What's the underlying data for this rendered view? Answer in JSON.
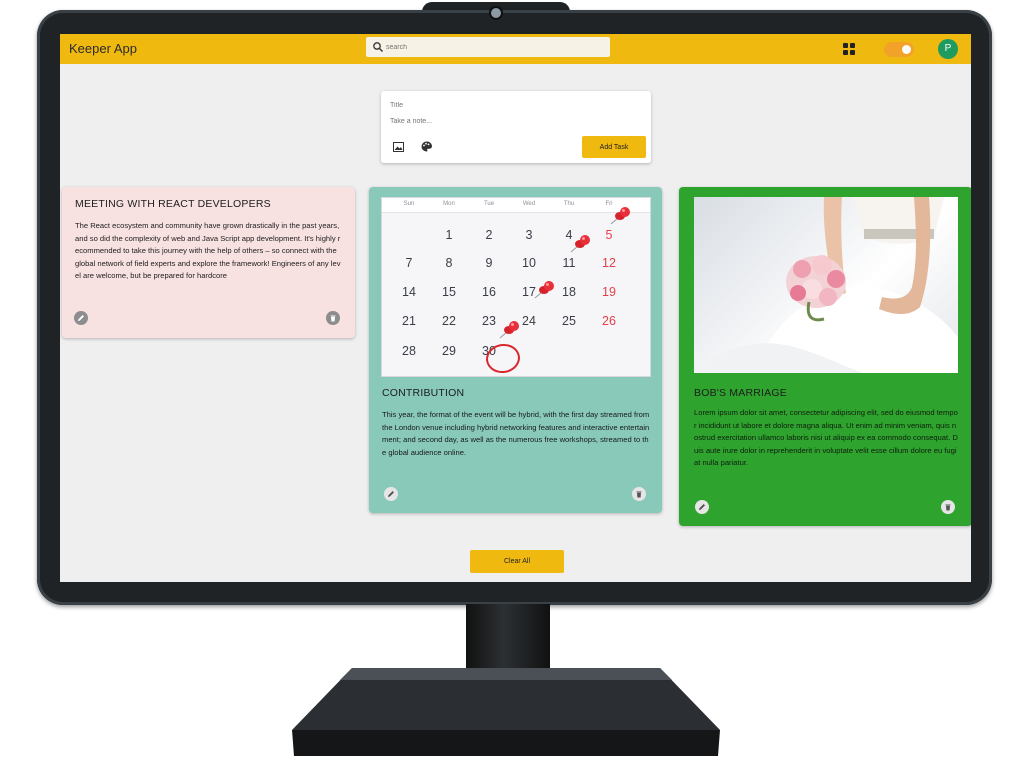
{
  "header": {
    "app_title": "Keeper App",
    "search_placeholder": "search",
    "avatar_letter": "P",
    "accent_color": "#f0b90f"
  },
  "composer": {
    "title_placeholder": "Title",
    "body_placeholder": "Take a note...",
    "add_button_label": "Add Task"
  },
  "notes": [
    {
      "title": "MEETING WITH REACT DEVELOPERS",
      "text": "The React ecosystem and community have grown drastically in the past years, and so did the complexity of web and Java Script app development. It's highly recommended to take this journey with the help of others – so connect with the global network of field experts and explore the framework! Engineers of any level are welcome, but be prepared for hardcore",
      "color": "#f8e1e1"
    },
    {
      "title": "CONTRIBUTION",
      "text": "This year, the format of the event will be hybrid, with the first day streamed from the London venue including hybrid networking features and interactive entertainment; and second day, as well as the numerous free workshops, streamed to the global audience online.",
      "color": "#88c9ba",
      "image": {
        "weekdays": [
          "Sun",
          "Mon",
          "Tue",
          "Wed",
          "Thu",
          "Fri"
        ],
        "rows": [
          [
            "",
            "1",
            "2",
            "3",
            "4",
            "5"
          ],
          [
            "7",
            "8",
            "9",
            "10",
            "11",
            "12"
          ],
          [
            "14",
            "15",
            "16",
            "17",
            "18",
            "19"
          ],
          [
            "21",
            "22",
            "23",
            "24",
            "25",
            "26"
          ],
          [
            "28",
            "29",
            "30",
            "",
            "",
            ""
          ]
        ],
        "circled_day": "30"
      }
    },
    {
      "title": "BOB'S MARRIAGE",
      "text": "Lorem ipsum dolor sit amet, consectetur adipiscing elit, sed do eiusmod tempor incididunt ut labore et dolore magna aliqua. Ut enim ad minim veniam, quis nostrud exercitation ullamco laboris nisi ut aliquip ex ea commodo consequat. Duis aute irure dolor in reprehenderit in voluptate velit esse cillum dolore eu fugiat nulla pariatur.",
      "color": "#2ea32e"
    }
  ],
  "footer": {
    "clear_all_label": "Clear All"
  },
  "icons": {
    "search": "search-icon",
    "apps": "grid-icon",
    "theme": "toggle-icon",
    "image": "image-icon",
    "palette": "palette-icon",
    "edit": "edit-icon",
    "delete": "delete-icon"
  }
}
